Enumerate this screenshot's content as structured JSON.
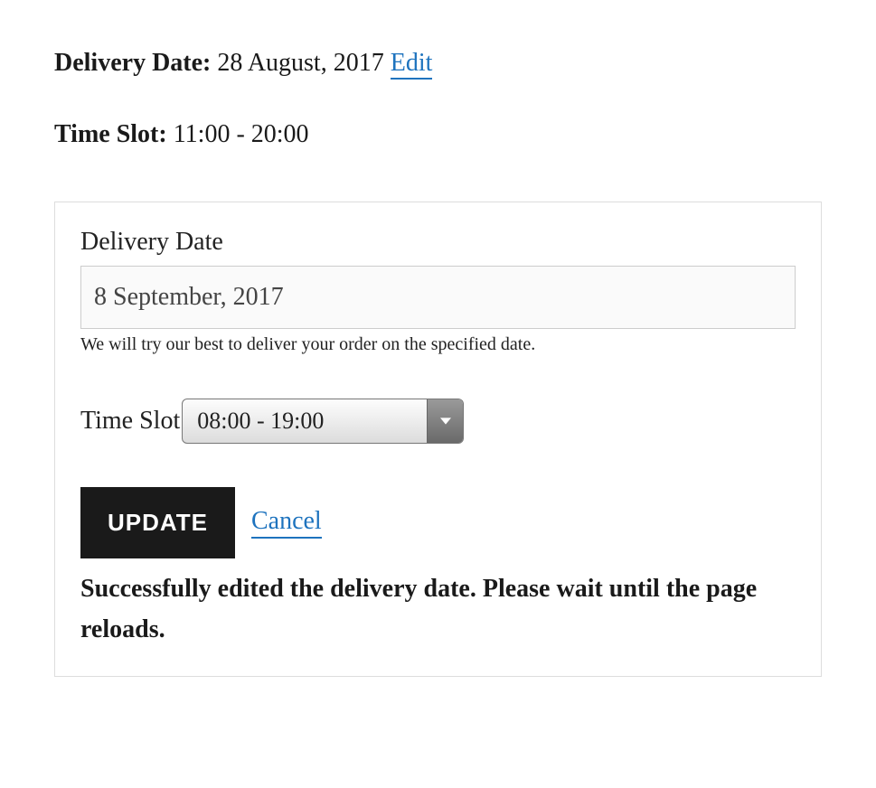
{
  "summary": {
    "delivery_date_label": "Delivery Date:",
    "delivery_date_value": "28 August, 2017",
    "edit_label": "Edit",
    "time_slot_label": "Time Slot:",
    "time_slot_value": "11:00 - 20:00"
  },
  "form": {
    "date_label": "Delivery Date",
    "date_value": "8 September, 2017",
    "date_helper": "We will try our best to deliver your order on the specified date.",
    "time_slot_label": "Time Slot",
    "time_slot_selected": "08:00 - 19:00",
    "update_label": "UPDATE",
    "cancel_label": "Cancel",
    "success_message": "Successfully edited the delivery date. Please wait until the page reloads."
  }
}
